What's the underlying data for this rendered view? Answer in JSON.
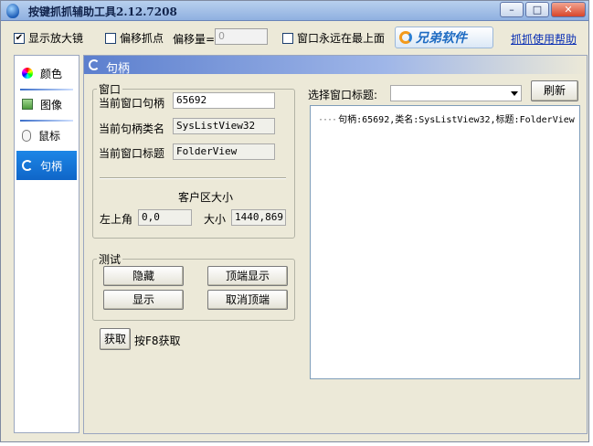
{
  "window": {
    "title": "按键抓抓辅助工具2.12.7208",
    "controls": {
      "minimize": "–",
      "maximize": "□",
      "close": "✕"
    }
  },
  "topbar": {
    "show_magnifier": {
      "label": "显示放大镜",
      "checked": true
    },
    "offset_grab": {
      "label": "偏移抓点",
      "checked": false
    },
    "offset_label": "偏移量=",
    "offset_value": "0",
    "always_on_top": {
      "label": "窗口永远在最上面",
      "checked": false
    },
    "logo_text": "兄弟软件",
    "help_link": "抓抓使用帮助"
  },
  "sidebar": {
    "items": [
      {
        "label": "颜色",
        "icon": "color-wheel-icon",
        "active": false
      },
      {
        "label": "图像",
        "icon": "image-icon",
        "active": false
      },
      {
        "label": "鼠标",
        "icon": "mouse-icon",
        "active": false
      },
      {
        "label": "句柄",
        "icon": "handle-icon",
        "active": true
      }
    ]
  },
  "main": {
    "header": "句柄",
    "window_group": {
      "legend": "窗口",
      "handle_label": "当前窗口句柄",
      "handle_value": "65692",
      "class_label": "当前句柄类名",
      "class_value": "SysListView32",
      "title_label": "当前窗口标题",
      "title_value": "FolderView",
      "client_size_title": "客户区大小",
      "topleft_label": "左上角",
      "topleft_value": "0,0",
      "size_label": "大小",
      "size_value": "1440,869"
    },
    "test_group": {
      "legend": "测试",
      "hide": "隐藏",
      "topmost": "顶端显示",
      "show": "显示",
      "cancel_topmost": "取消顶端"
    },
    "get_button": "获取",
    "get_hint": "按F8获取",
    "select_window_label": "选择窗口标题:",
    "select_window_value": "",
    "refresh_button": "刷新",
    "tree_items": [
      {
        "prefix": "····",
        "text": "句柄:65692,类名:SysListView32,标题:FolderView"
      }
    ]
  }
}
